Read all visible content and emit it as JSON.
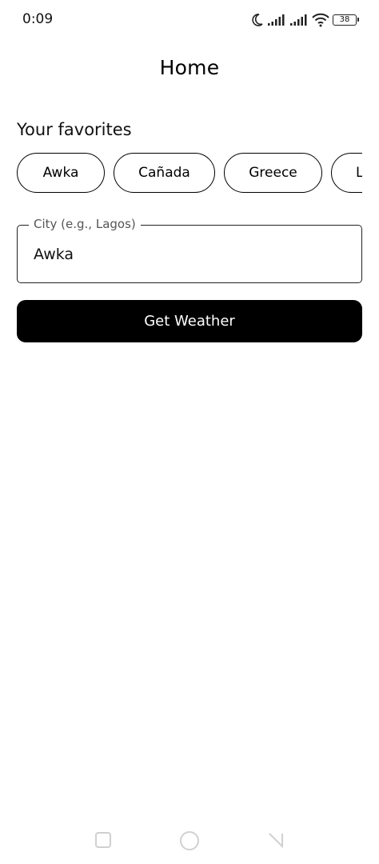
{
  "status_bar": {
    "time": "0:09",
    "battery": "38",
    "icons": [
      "moon-icon",
      "signal-icon",
      "signal-icon",
      "wifi-icon",
      "battery-icon"
    ]
  },
  "app_bar": {
    "title": "Home"
  },
  "favorites": {
    "label": "Your favorites",
    "chips": [
      "Awka",
      "Cañada",
      "Greece",
      "L"
    ]
  },
  "city_field": {
    "label": "City (e.g., Lagos)",
    "value": "Awka"
  },
  "actions": {
    "get_weather": "Get Weather"
  },
  "nav_bar": {
    "icons": [
      "recents-icon",
      "home-icon",
      "back-icon"
    ]
  },
  "colors": {
    "accent": "#000000",
    "background": "#ffffff",
    "label": "#555555"
  }
}
